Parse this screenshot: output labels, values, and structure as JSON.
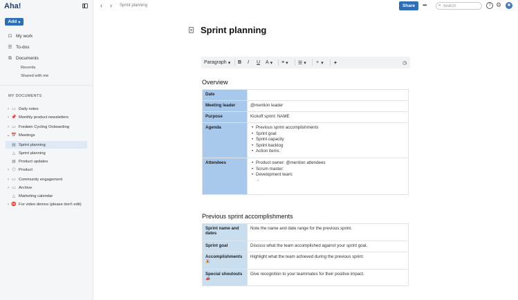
{
  "app": {
    "logo": "Aha!"
  },
  "sidebar": {
    "add_label": "Add",
    "nav": [
      {
        "label": "My work",
        "icon": "briefcase-icon"
      },
      {
        "label": "To-dos",
        "icon": "checklist-icon"
      },
      {
        "label": "Documents",
        "icon": "documents-icon"
      }
    ],
    "documents_sub": [
      "Recents",
      "Shared with me"
    ],
    "section_label": "MY DOCUMENTS",
    "docs": [
      {
        "label": "Daily notes",
        "chevron": true,
        "icon": "folder-icon"
      },
      {
        "label": "Monthly product newsletters",
        "chevron": true,
        "icon": "pin-icon"
      },
      {
        "label": "Fredwin Cycling Onboarding",
        "chevron": true,
        "icon": "folder-icon"
      },
      {
        "label": "Meetings",
        "chevron": true,
        "icon": "calendar-icon"
      },
      {
        "label": "Sprint planning",
        "chevron": false,
        "icon": "document-icon",
        "active": true
      },
      {
        "label": "Sprint planning",
        "chevron": false,
        "icon": "whiteboard-icon"
      },
      {
        "label": "Product updates",
        "chevron": false,
        "icon": "document-icon"
      },
      {
        "label": "Product",
        "chevron": true,
        "icon": "cube-icon"
      },
      {
        "label": "Community engagement",
        "chevron": true,
        "icon": "folder-icon"
      },
      {
        "label": "Archive",
        "chevron": true,
        "icon": "folder-icon"
      },
      {
        "label": "Marketing calendar",
        "chevron": false,
        "icon": "whiteboard-icon"
      },
      {
        "label": "For video demos (please don't edit)",
        "chevron": true,
        "icon": "no-entry-icon"
      }
    ]
  },
  "topbar": {
    "breadcrumb": "Sprint planning",
    "share_label": "Share",
    "search_placeholder": "Search"
  },
  "document": {
    "title": "Sprint planning",
    "toolbar": {
      "paragraph_label": "Paragraph",
      "bold": "B",
      "italic": "I",
      "underline": "U",
      "text_color": "A",
      "insert": "+"
    },
    "overview": {
      "heading": "Overview",
      "rows": [
        {
          "label": "Date",
          "value": ""
        },
        {
          "label": "Meeting leader",
          "value": "@mention leader"
        },
        {
          "label": "Purpose",
          "value": "Kickoff sprint: NAME"
        },
        {
          "label": "Agenda",
          "items": [
            "Previous sprint accomplishments",
            "Sprint goal",
            "Sprint capacity",
            "Sprint backlog",
            "Action items"
          ]
        },
        {
          "label": "Attendees",
          "items": [
            "Product owner: @mention attendees",
            "Scrum master:",
            "Development team:"
          ]
        }
      ]
    },
    "previous": {
      "heading": "Previous sprint accomplishments",
      "rows": [
        {
          "label": "Sprint name and dates",
          "value": "Note the name and date range for the previous sprint."
        },
        {
          "label": "Sprint goal",
          "value": "Discuss what the team accomplished against your sprint goal."
        },
        {
          "label": "Accomplishments",
          "emoji": "🎉",
          "value": "Highlight what the team achieved during the previous sprint."
        },
        {
          "label": "Special shoutouts",
          "emoji": "📣",
          "value": "Give recognition to your teammates for their positive impact."
        }
      ]
    }
  },
  "colors": {
    "accent": "#2d6fb6",
    "overview_label_bg": "#a8c8ec",
    "previous_label_bg": "#c9dff0"
  }
}
